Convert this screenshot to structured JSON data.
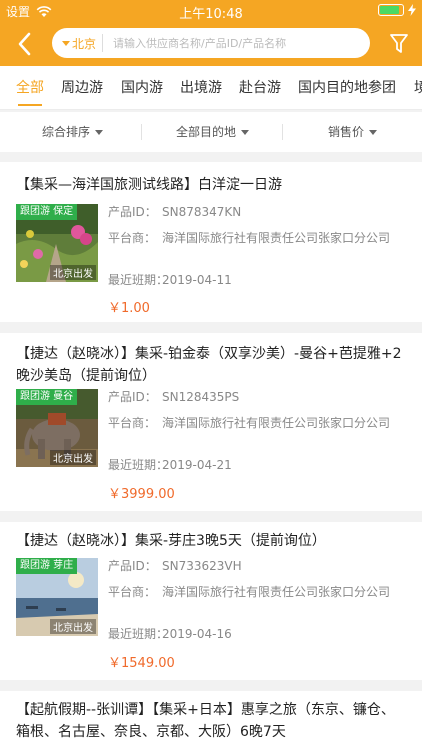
{
  "status_bar": {
    "carrier": "设置",
    "time": "上午10:48"
  },
  "header": {
    "city": "北京",
    "search_placeholder": "请输入供应商名称/产品ID/产品名称",
    "colors": {
      "brand": "#f5a623",
      "price": "#f06a2b",
      "tag": "#2fae4a"
    }
  },
  "tabs": [
    {
      "label": "全部",
      "active": true
    },
    {
      "label": "周边游"
    },
    {
      "label": "国内游"
    },
    {
      "label": "出境游"
    },
    {
      "label": "赴台游"
    },
    {
      "label": "国内目的地参团"
    },
    {
      "label": "境"
    }
  ],
  "sort": {
    "comprehensive": "综合排序",
    "destination": "全部目的地",
    "sales": "销售价"
  },
  "labels": {
    "product_id": "产品ID：",
    "platform": "平台商：",
    "recent": "最近班期："
  },
  "products": [
    {
      "title": "【集采—海洋国旅测试线路】白洋淀一日游",
      "tag": "跟团游 保定",
      "departure": "北京出发",
      "product_id": "SN878347KN",
      "platform": "海洋国际旅行社有限责任公司张家口分公司",
      "recent_date": "2019-04-11",
      "price": "￥1.00"
    },
    {
      "title": "【捷达（赵晓冰）】集采-铂金泰（双享沙美）-曼谷+芭提雅+2晚沙美岛（提前询位）",
      "tag": "跟团游 曼谷",
      "departure": "北京出发",
      "product_id": "SN128435PS",
      "platform": "海洋国际旅行社有限责任公司张家口分公司",
      "recent_date": "2019-04-21",
      "price": "￥3999.00"
    },
    {
      "title": "【捷达（赵晓冰）】集采-芽庄3晚5天（提前询位）",
      "tag": "跟团游 芽庄",
      "departure": "北京出发",
      "product_id": "SN733623VH",
      "platform": "海洋国际旅行社有限责任公司张家口分公司",
      "recent_date": "2019-04-16",
      "price": "￥1549.00"
    },
    {
      "title": "【起航假期--张训谭】【集采+日本】惠享之旅（东京、镰仓、箱根、名古屋、奈良、京都、大阪）6晚7天"
    }
  ]
}
